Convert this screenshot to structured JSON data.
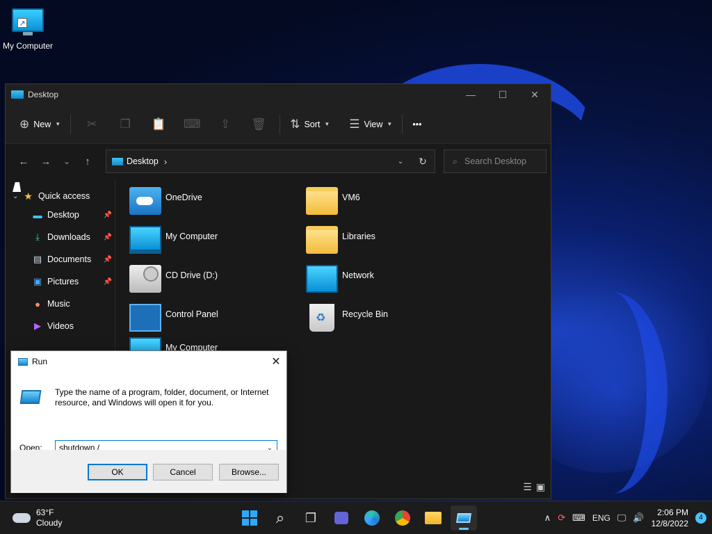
{
  "desktop": {
    "icon_label": "My Computer"
  },
  "explorer": {
    "title": "Desktop",
    "toolbar": {
      "new_label": "New",
      "sort_label": "Sort",
      "view_label": "View",
      "more": "•••"
    },
    "address": {
      "location": "Desktop",
      "search_placeholder": "Search Desktop"
    },
    "sidebar": {
      "quick_access": "Quick access",
      "items": [
        {
          "label": "Desktop",
          "pinned": true
        },
        {
          "label": "Downloads",
          "pinned": true
        },
        {
          "label": "Documents",
          "pinned": true
        },
        {
          "label": "Pictures",
          "pinned": true
        },
        {
          "label": "Music",
          "pinned": false
        },
        {
          "label": "Videos",
          "pinned": false
        }
      ]
    },
    "files": [
      {
        "name": "OneDrive",
        "icon": "onedrive-folder-icon"
      },
      {
        "name": "VM6",
        "icon": "folder-icon"
      },
      {
        "name": "My Computer",
        "icon": "computer-icon"
      },
      {
        "name": "Libraries",
        "icon": "folder-icon"
      },
      {
        "name": "CD Drive (D:)",
        "icon": "cd-drive-icon"
      },
      {
        "name": "Network",
        "icon": "network-icon"
      },
      {
        "name": "Control Panel",
        "icon": "control-panel-icon"
      },
      {
        "name": "Recycle Bin",
        "icon": "recycle-bin-icon"
      },
      {
        "name": "My Computer",
        "icon": "computer-icon"
      }
    ]
  },
  "run_dialog": {
    "title": "Run",
    "description": "Type the name of a program, folder, document, or Internet resource, and Windows will open it for you.",
    "open_label": "Open:",
    "input_value": "shutdown /",
    "ok_label": "OK",
    "cancel_label": "Cancel",
    "browse_label": "Browse..."
  },
  "taskbar": {
    "weather": {
      "temp": "63°F",
      "condition": "Cloudy"
    },
    "language": "ENG",
    "time": "2:06 PM",
    "date": "12/8/2022",
    "notification_count": "4"
  }
}
